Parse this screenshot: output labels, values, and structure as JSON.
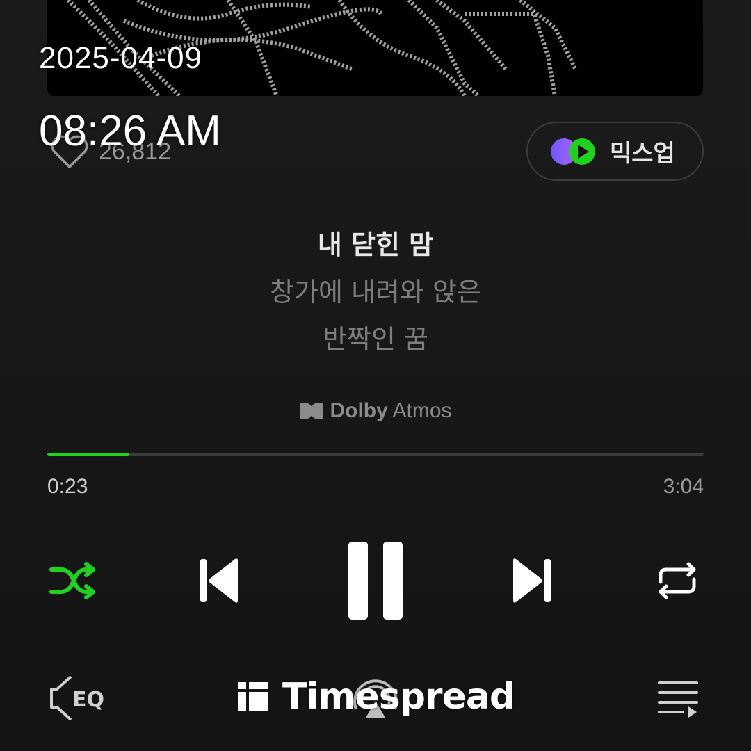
{
  "overlay": {
    "date": "2025-04-09",
    "time": "08:26 AM"
  },
  "track": {
    "like_count": "26,812",
    "mixup_label": "믹스업"
  },
  "lyrics": {
    "current": "내 닫힌 맘",
    "next_lines": [
      "창가에 내려와 앉은",
      "반짝인 꿈"
    ]
  },
  "badge": {
    "dolby_brand": "Dolby",
    "dolby_suffix": "Atmos"
  },
  "progress": {
    "elapsed": "0:23",
    "total": "3:04",
    "fraction": 0.125
  },
  "controls": {
    "shuffle_icon": "shuffle-icon",
    "prev_icon": "skip-previous-icon",
    "pause_icon": "pause-icon",
    "next_icon": "skip-next-icon",
    "repeat_icon": "repeat-icon",
    "eq_label": "EQ",
    "cast_icon": "cast-icon",
    "playlist_icon": "playlist-icon"
  },
  "watermark": {
    "text": "Timespread"
  },
  "colors": {
    "accent": "#1ed31e",
    "background": "#161616",
    "muted_text": "#7d7d7d"
  }
}
